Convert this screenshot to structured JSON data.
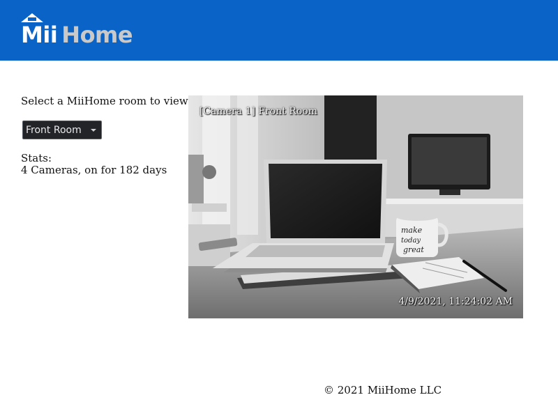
{
  "header": {
    "logo_mii": "Mii",
    "logo_home": "Home",
    "color": "#0a64c8"
  },
  "sidebar": {
    "prompt": "Select a MiiHome room to view:",
    "room_select": {
      "selected": "Front Room"
    },
    "stats_label": "Stats:",
    "stats_value": "4 Cameras, on for 182 days"
  },
  "camera": {
    "overlay_label": "[Camera 1] Front Room",
    "timestamp": "4/9/2021, 11:24:02 AM",
    "feed": "grayscale living room: laptop, mug, notebook, pen, tv"
  },
  "footer": {
    "copyright": "© 2021 MiiHome LLC"
  }
}
